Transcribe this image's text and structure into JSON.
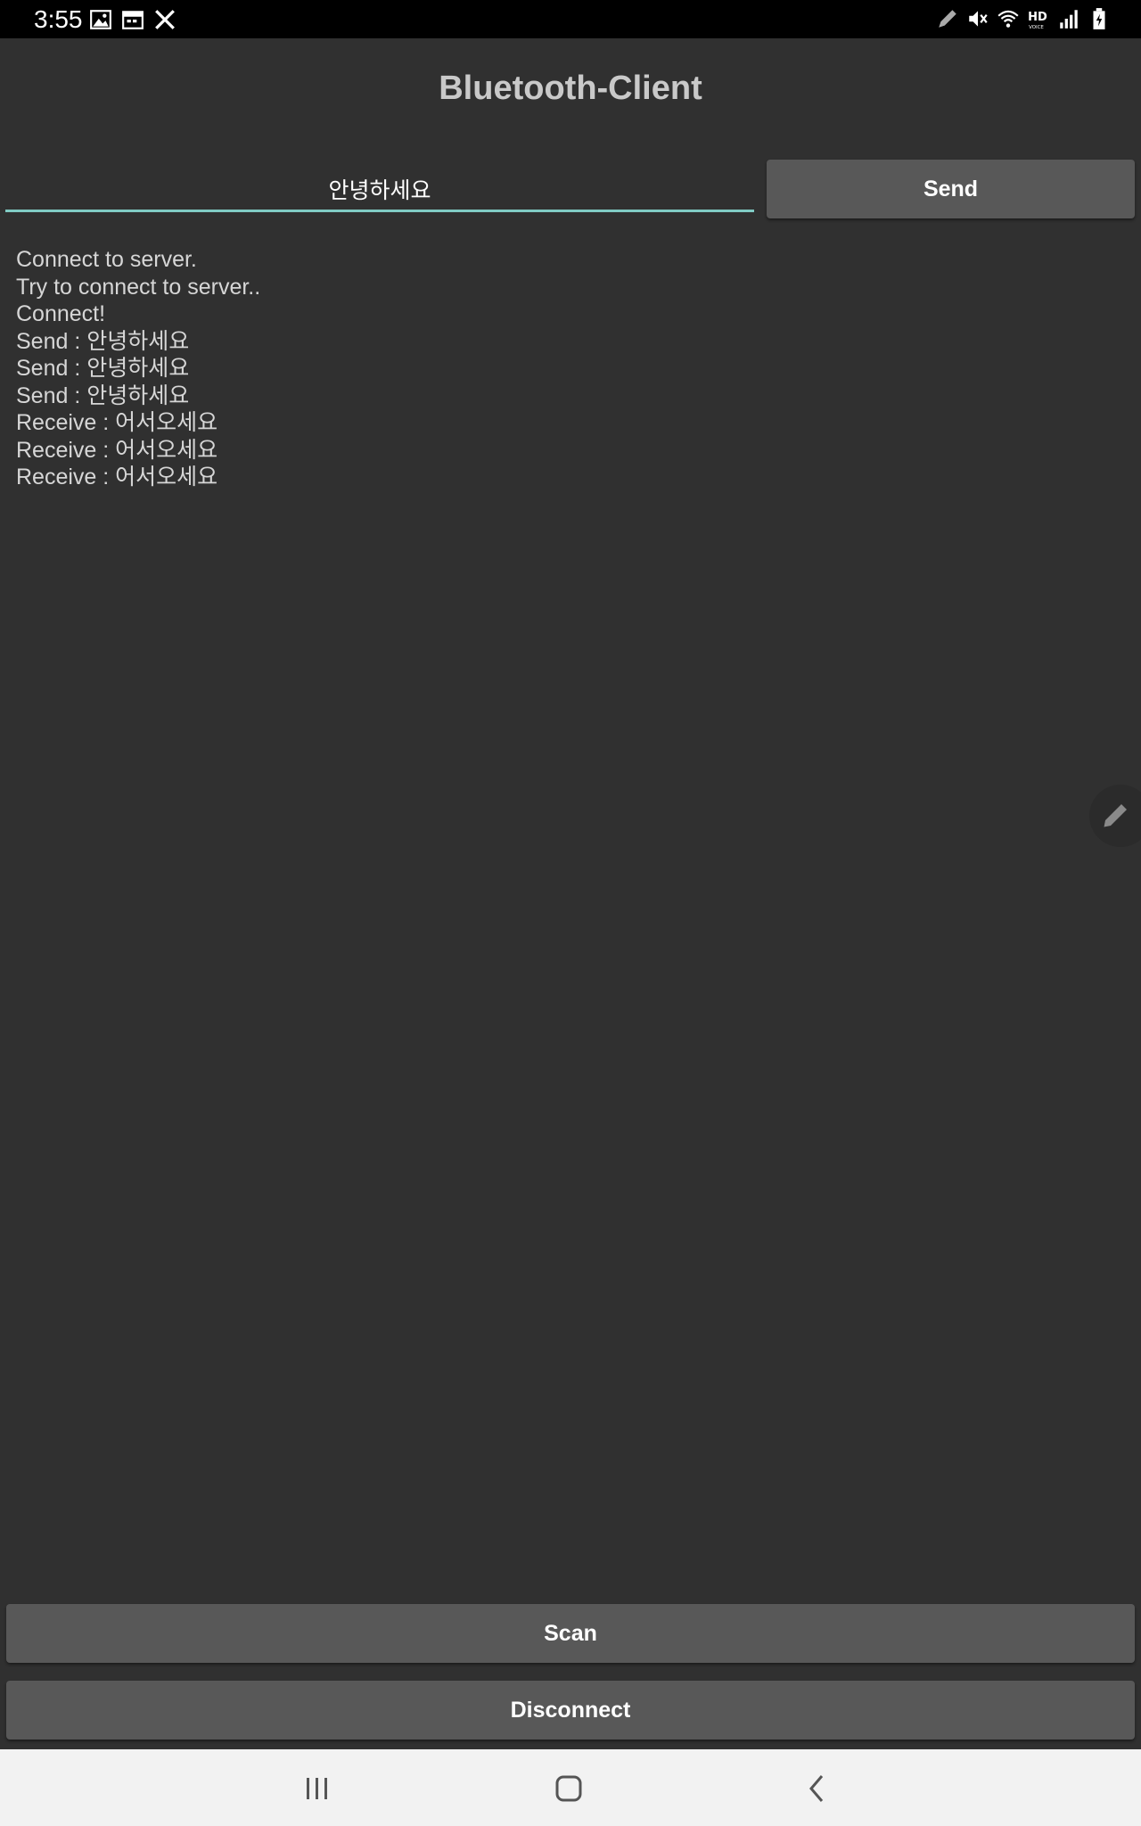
{
  "status_bar": {
    "time": "3:55",
    "left_icons": [
      "gallery-icon",
      "calendar-icon",
      "tools-icon"
    ],
    "right_icons": [
      "pen-icon",
      "mute-icon",
      "wifi-icon",
      "hd-voice-icon",
      "signal-icon",
      "battery-charging-icon"
    ]
  },
  "app": {
    "title": "Bluetooth-Client"
  },
  "message": {
    "input_value": "안녕하세요",
    "send_label": "Send"
  },
  "log": {
    "lines": [
      "Connect to server.",
      "Try to connect to server..",
      "Connect!",
      "Send : 안녕하세요",
      "Send : 안녕하세요",
      "Send : 안녕하세요",
      "Receive : 어서오세요",
      "Receive : 어서오세요",
      "Receive : 어서오세요"
    ]
  },
  "buttons": {
    "scan_label": "Scan",
    "disconnect_label": "Disconnect"
  },
  "nav": {
    "icons": [
      "recents-icon",
      "home-icon",
      "back-icon"
    ]
  },
  "colors": {
    "background": "#303030",
    "input_underline": "#80cbc4",
    "button": "#585858"
  }
}
